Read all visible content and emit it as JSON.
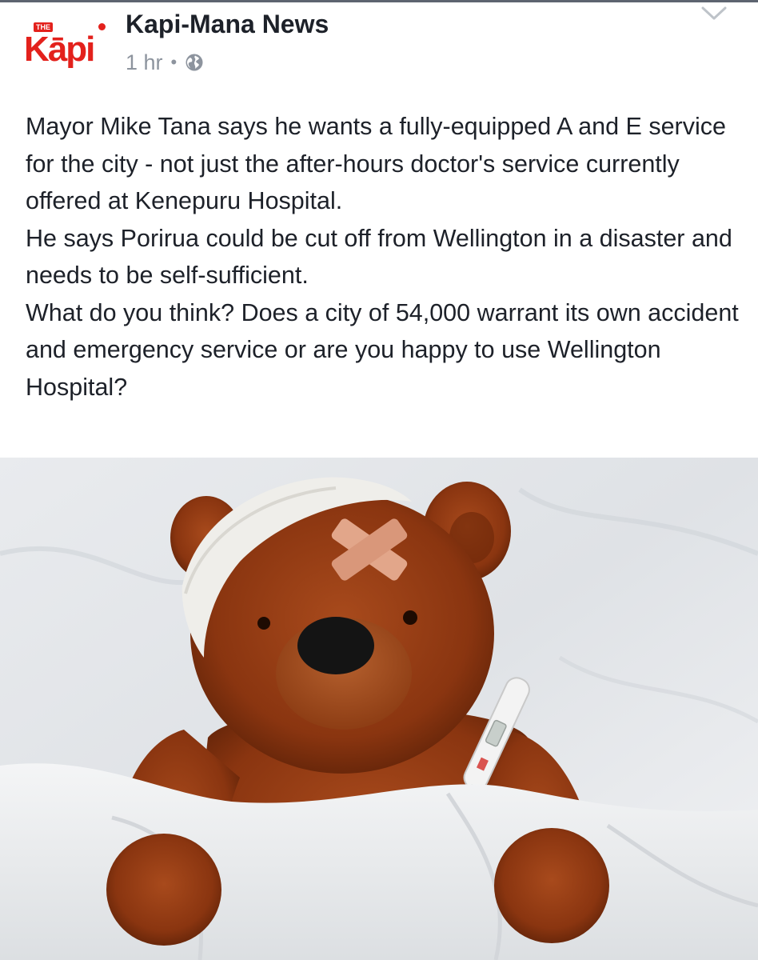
{
  "page": {
    "name": "Kapi-Mana News",
    "logo_text": "Kāpi",
    "logo_tag": "THE",
    "timestamp": "1 hr",
    "separator": "•",
    "privacy_icon": "globe-icon",
    "menu_icon": "chevron-down-icon"
  },
  "post": {
    "paragraphs": [
      "Mayor Mike Tana says he wants a fully-equipped A and E service for the city - not just the after-hours doctor's service currently offered at Kenepuru Hospital.",
      "He says Porirua could be cut off from Wellington in a disaster and needs to be self-sufficient.",
      "What do you think? Does a city of 54,000 warrant its own accident and emergency service or are you happy to use Wellington Hospital?"
    ]
  },
  "photo": {
    "subject": "teddy-bear-in-bed-with-bandage-and-thermometer"
  },
  "colors": {
    "brand_red": "#e3211c",
    "text_primary": "#1d2129",
    "text_secondary": "#8d949e"
  }
}
